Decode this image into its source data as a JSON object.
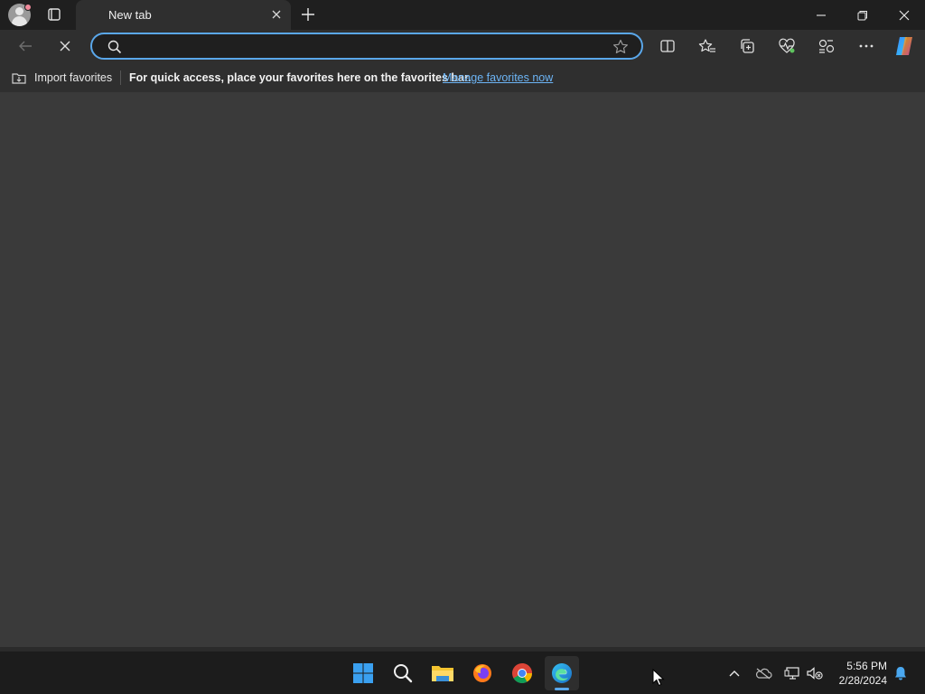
{
  "tab": {
    "title": "New tab"
  },
  "address": {
    "value": "",
    "placeholder": ""
  },
  "favorites_bar": {
    "import_label": "Import favorites",
    "message": "For quick access, place your favorites here on the favorites bar.",
    "link": "Manage favorites now"
  },
  "clock": {
    "time": "5:56 PM",
    "date": "2/28/2024"
  },
  "colors": {
    "accent": "#5aa7ea",
    "content_bg": "#3a3a3a",
    "link": "#6cb4f5"
  }
}
